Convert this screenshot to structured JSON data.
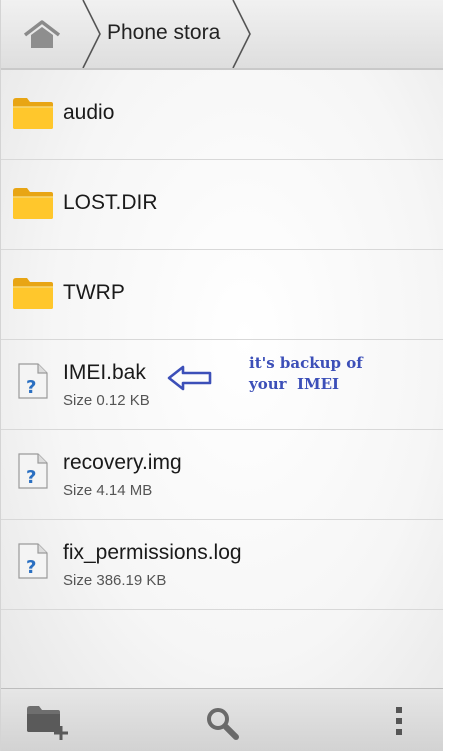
{
  "header": {
    "home_icon": "home-icon",
    "breadcrumb_label": "Phone stora"
  },
  "items": [
    {
      "type": "folder",
      "name": "audio"
    },
    {
      "type": "folder",
      "name": "LOST.DIR"
    },
    {
      "type": "folder",
      "name": "TWRP"
    },
    {
      "type": "file",
      "name": "IMEI.bak",
      "size": "Size 0.12 KB"
    },
    {
      "type": "file",
      "name": "recovery.img",
      "size": "Size 4.14 MB"
    },
    {
      "type": "file",
      "name": "fix_permissions.log",
      "size": "Size 386.19 KB"
    }
  ],
  "annotation": {
    "line1": "it's backup of",
    "line2": "your  IMEI",
    "color": "#3c4fb8"
  },
  "toolbar": {
    "new_folder_icon": "new-folder-icon",
    "search_icon": "search-icon",
    "overflow_icon": "overflow-menu-icon"
  }
}
